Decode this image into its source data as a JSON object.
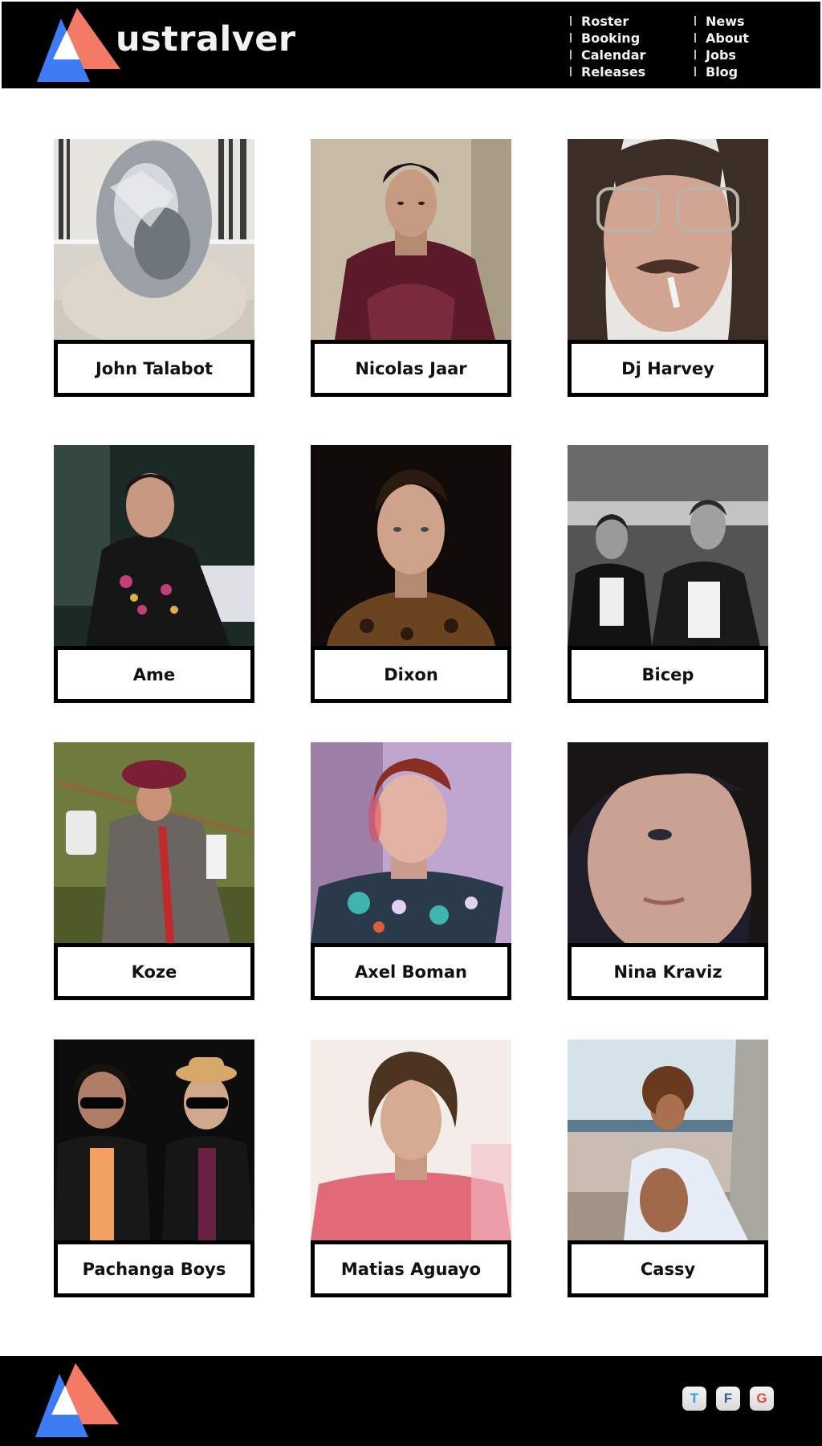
{
  "brand": {
    "logo_text": "ustralver",
    "colors": {
      "blue": "#3d7cf4",
      "coral": "#f57a66",
      "white": "#ffffff"
    }
  },
  "nav": {
    "col1": [
      "Roster",
      "Booking",
      "Calendar",
      "Releases"
    ],
    "col2": [
      "News",
      "About",
      "Jobs",
      "Blog"
    ]
  },
  "artists": [
    {
      "name": "John Talabot"
    },
    {
      "name": "Nicolas Jaar"
    },
    {
      "name": "Dj Harvey"
    },
    {
      "name": "Ame"
    },
    {
      "name": "Dixon"
    },
    {
      "name": "Bicep"
    },
    {
      "name": "Koze"
    },
    {
      "name": "Axel Boman"
    },
    {
      "name": "Nina Kraviz"
    },
    {
      "name": "Pachanga Boys"
    },
    {
      "name": "Matias Aguayo"
    },
    {
      "name": "Cassy"
    }
  ],
  "social": [
    {
      "icon": "twitter-icon",
      "label": "T"
    },
    {
      "icon": "facebook-icon",
      "label": "F"
    },
    {
      "icon": "google-plus-icon",
      "label": "G"
    }
  ]
}
